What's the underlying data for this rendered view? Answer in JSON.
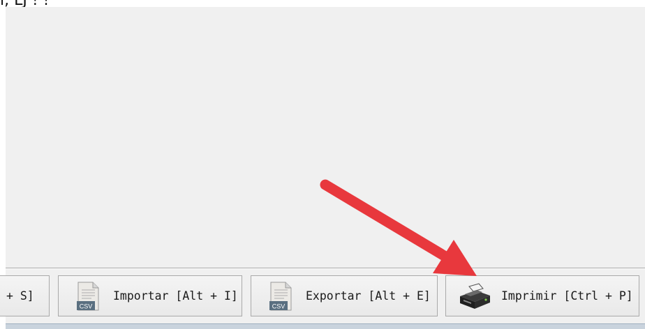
{
  "page": {
    "top_fragment_text": "ı, LJ ! !"
  },
  "toolbar": {
    "save_label": "+ S]",
    "import_label": "Importar [Alt + I]",
    "export_label": "Exportar [Alt + E]",
    "print_label": "Imprimir [Ctrl + P]",
    "csv_badge": "CSV"
  },
  "icons": {
    "import": "csv-file-icon",
    "export": "csv-file-icon",
    "print": "printer-icon"
  },
  "colors": {
    "panel_bg": "#f0f0f0",
    "button_border": "#a9a9a9",
    "annotation_arrow": "#e8383d"
  }
}
